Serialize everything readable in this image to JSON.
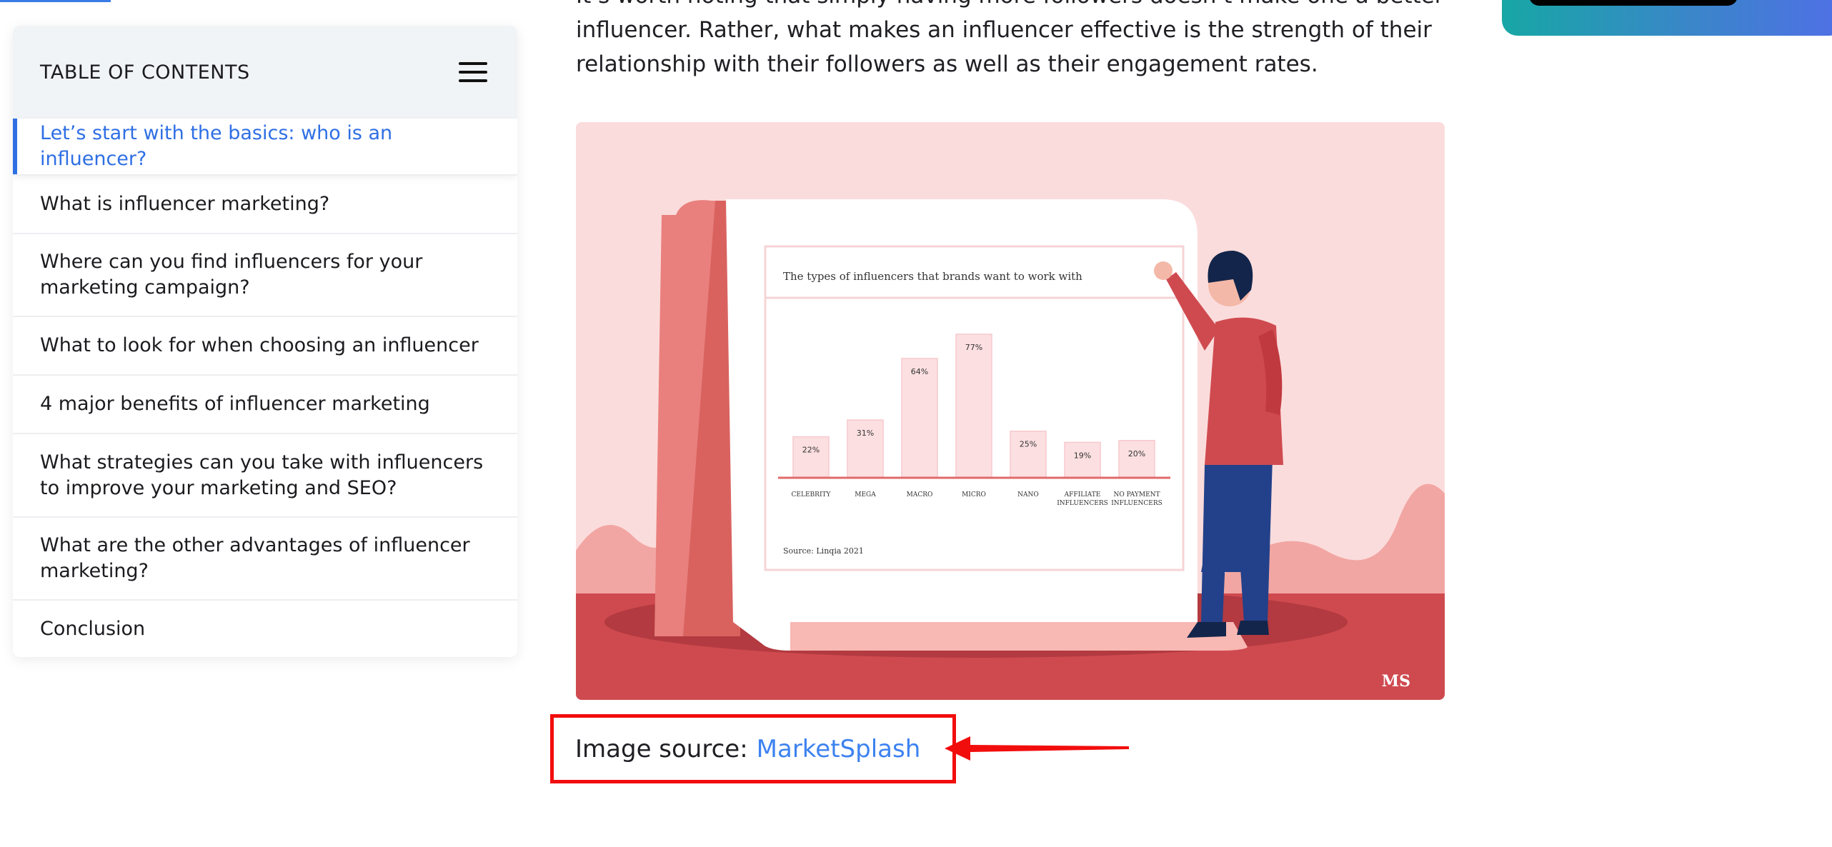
{
  "toc": {
    "title": "TABLE OF CONTENTS",
    "menu_icon": "hamburger-menu-icon",
    "items": [
      {
        "label": "Let’s start with the basics: who is an influencer?",
        "active": true
      },
      {
        "label": "What is influencer marketing?"
      },
      {
        "label": "Where can you find influencers for your marketing campaign?"
      },
      {
        "label": "What to look for when choosing an influencer"
      },
      {
        "label": "4 major benefits of influencer marketing"
      },
      {
        "label": "What strategies can you take with influencers to improve your marketing and SEO?"
      },
      {
        "label": "What are the other advantages of influencer marketing?"
      },
      {
        "label": "Conclusion"
      }
    ]
  },
  "article": {
    "line_clipped": "It’s worth noting that simply having more followers doesn’t make one a better",
    "line2": "influencer. Rather, what makes an influencer effective is the strength of their",
    "line3": "relationship with their followers as well as their engagement rates."
  },
  "figure": {
    "logo": "MS",
    "colors": {
      "background": "#fbdcdc",
      "floor": "#cf4a4f",
      "bar": "#fcdfe1",
      "baseline": "#e06a6a"
    }
  },
  "chart_data": {
    "type": "bar",
    "title": "The types of influencers that brands want to work with",
    "categories": [
      "CELEBRITY",
      "MEGA",
      "MACRO",
      "MICRO",
      "NANO",
      "AFFILIATE INFLUENCERS",
      "NO PAYMENT INFLUENCERS"
    ],
    "values": [
      22,
      31,
      64,
      77,
      25,
      19,
      20
    ],
    "value_labels": [
      "22%",
      "31%",
      "64%",
      "77%",
      "25%",
      "19%",
      "20%"
    ],
    "source": "Source: Linqia 2021",
    "ylim": [
      0,
      100
    ]
  },
  "caption": {
    "prefix": "Image source:",
    "link": "MarketSplash",
    "highlight_color": "#f20d0d"
  }
}
